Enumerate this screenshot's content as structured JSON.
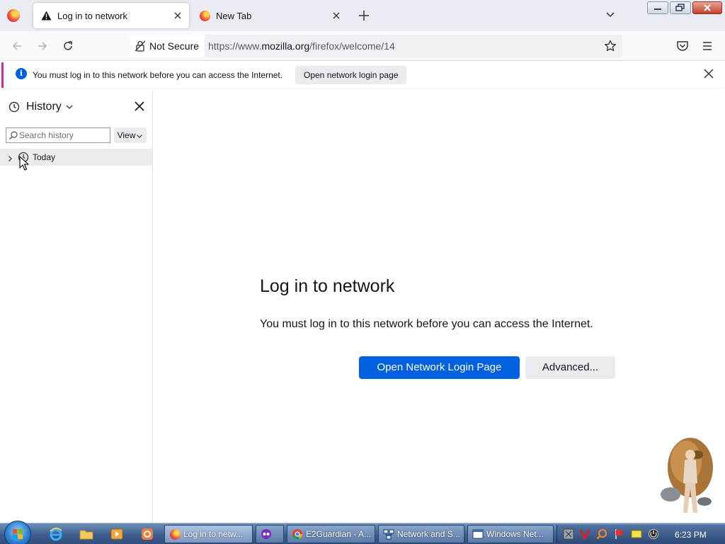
{
  "tabs": [
    {
      "label": "Log in to network",
      "icon": "warning-icon",
      "active": true
    },
    {
      "label": "New Tab",
      "icon": "firefox-icon",
      "active": false
    }
  ],
  "toolbar": {
    "security_label": "Not Secure",
    "url_prefix": "https://www.",
    "url_host": "mozilla.org",
    "url_path": "/firefox/welcome/14"
  },
  "notification": {
    "message": "You must log in to this network before you can access the Internet.",
    "button_label": "Open network login page"
  },
  "sidebar": {
    "title": "History",
    "search_placeholder": "Search history",
    "view_label": "View",
    "items": [
      {
        "label": "Today",
        "expanded": false
      }
    ]
  },
  "page": {
    "title": "Log in to network",
    "description": "You must log in to this network before you can access the Internet.",
    "primary_button": "Open Network Login Page",
    "secondary_button": "Advanced..."
  },
  "taskbar": {
    "items": [
      {
        "label": "Log in to netw...",
        "icon": "firefox-icon",
        "active": true
      },
      {
        "label": "",
        "icon": "app-icon",
        "active": false
      },
      {
        "label": "E2Guardian - A...",
        "icon": "chrome-icon",
        "active": false
      },
      {
        "label": "Network and S...",
        "icon": "network-icon",
        "active": false
      },
      {
        "label": "Windows Net...",
        "icon": "window-icon",
        "active": false
      }
    ],
    "clock": "6:23 PM"
  },
  "colors": {
    "accent": "#0061e0",
    "notification_border": "#d0279a",
    "tabstrip": "#e9ecf3"
  }
}
